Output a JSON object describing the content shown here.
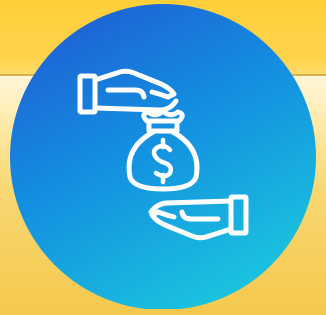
{
  "emblem": {
    "icons": [
      "money-bag-icon",
      "giving-hand-icon",
      "receiving-hand-icon",
      "dollar-sign-icon"
    ],
    "colors": {
      "circle_top": "#1f62d6",
      "circle_mid": "#0f9fe0",
      "circle_bottom": "#19c6df",
      "line": "#ffffff",
      "background_gold": "#ffd24a"
    }
  }
}
